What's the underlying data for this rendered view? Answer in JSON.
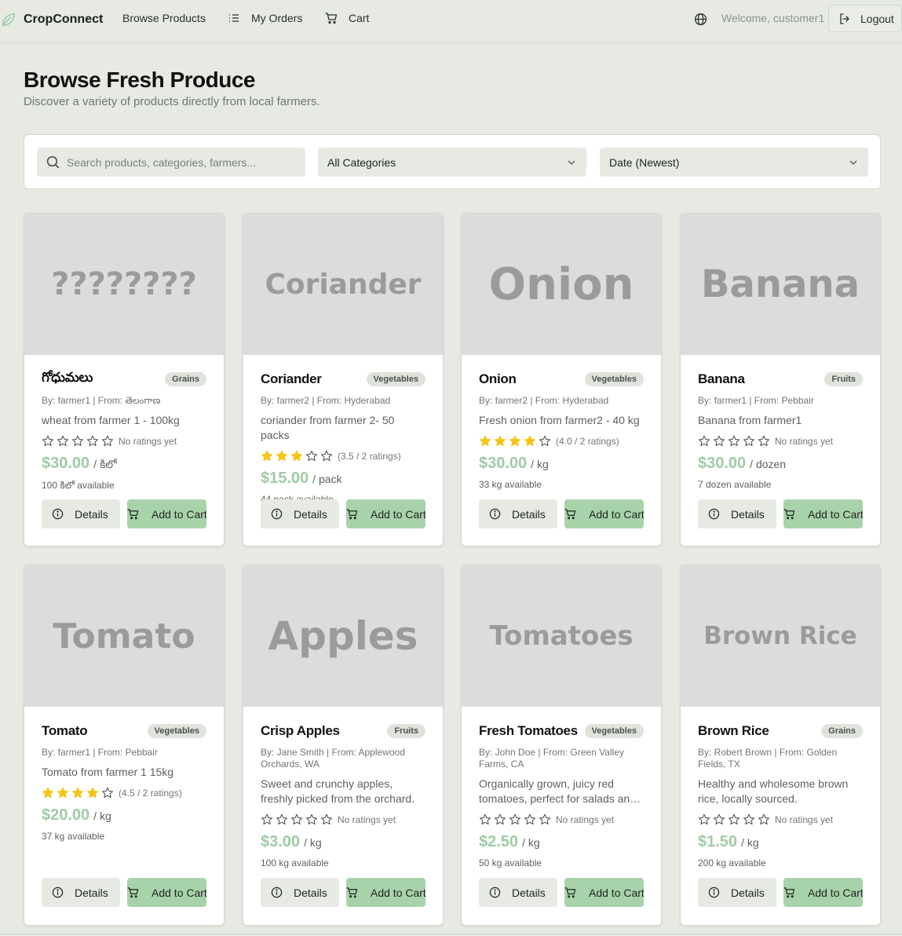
{
  "nav": {
    "brand": "CropConnect",
    "links": [
      {
        "label": "Browse Products",
        "icon": "none"
      },
      {
        "label": "My Orders",
        "icon": "list-icon"
      },
      {
        "label": "Cart",
        "icon": "cart-icon"
      }
    ],
    "welcome": "Welcome, customer1",
    "logout": "Logout"
  },
  "header": {
    "title": "Browse Fresh Produce",
    "subtitle": "Discover a variety of products directly from local farmers."
  },
  "filters": {
    "search_placeholder": "Search products, categories, farmers...",
    "category": "All Categories",
    "sort": "Date (Newest)"
  },
  "buttons": {
    "details": "Details",
    "add_to_cart": "Add to Cart"
  },
  "colors": {
    "accent": "#a8d3aa",
    "price": "#9fcba4",
    "star": "#f5c518",
    "background": "#e6eae3"
  },
  "products": [
    {
      "image_text": "????????",
      "name": "గోధుమలు",
      "category": "Grains",
      "by": "By: farmer1 | From: తెలంగాణ",
      "desc": "wheat from farmer 1 - 100kg",
      "stars": 0,
      "rating_text": "No ratings yet",
      "price": "$30.00",
      "unit": "/ కిలో",
      "available": "100 కిలో available"
    },
    {
      "image_text": "Coriander",
      "name": "Coriander",
      "category": "Vegetables",
      "by": "By: farmer2 | From: Hyderabad",
      "desc": "coriander from farmer 2- 50 packs",
      "stars": 3,
      "rating_text": "(3.5 / 2 ratings)",
      "price": "$15.00",
      "unit": "/ pack",
      "available": "44 pack available"
    },
    {
      "image_text": "Onion",
      "name": "Onion",
      "category": "Vegetables",
      "by": "By: farmer2 | From: Hyderabad",
      "desc": "Fresh onion from farmer2 - 40 kg",
      "stars": 4,
      "rating_text": "(4.0 / 2 ratings)",
      "price": "$30.00",
      "unit": "/ kg",
      "available": "33 kg available"
    },
    {
      "image_text": "Banana",
      "name": "Banana",
      "category": "Fruits",
      "by": "By: farmer1 | From: Pebbair",
      "desc": "Banana from farmer1",
      "stars": 0,
      "rating_text": "No ratings yet",
      "price": "$30.00",
      "unit": "/ dozen",
      "available": "7 dozen available"
    },
    {
      "image_text": "Tomato",
      "name": "Tomato",
      "category": "Vegetables",
      "by": "By: farmer1 | From: Pebbair",
      "desc": "Tomato from farmer 1 15kg",
      "stars": 4,
      "rating_text": "(4.5 / 2 ratings)",
      "price": "$20.00",
      "unit": "/ kg",
      "available": "37 kg available"
    },
    {
      "image_text": "Apples",
      "name": "Crisp Apples",
      "category": "Fruits",
      "by": "By: Jane Smith | From: Applewood Orchards, WA",
      "desc": "Sweet and crunchy apples, freshly picked from the orchard.",
      "stars": 0,
      "rating_text": "No ratings yet",
      "price": "$3.00",
      "unit": "/ kg",
      "available": "100 kg available"
    },
    {
      "image_text": "Tomatoes",
      "name": "Fresh Tomatoes",
      "category": "Vegetables",
      "by": "By: John Doe | From: Green Valley Farms, CA",
      "desc": "Organically grown, juicy red tomatoes, perfect for salads an…",
      "stars": 0,
      "rating_text": "No ratings yet",
      "price": "$2.50",
      "unit": "/ kg",
      "available": "50 kg available"
    },
    {
      "image_text": "Brown Rice",
      "name": "Brown Rice",
      "category": "Grains",
      "by": "By: Robert Brown | From: Golden Fields, TX",
      "desc": "Healthy and wholesome brown rice, locally sourced.",
      "stars": 0,
      "rating_text": "No ratings yet",
      "price": "$1.50",
      "unit": "/ kg",
      "available": "200 kg available"
    }
  ]
}
